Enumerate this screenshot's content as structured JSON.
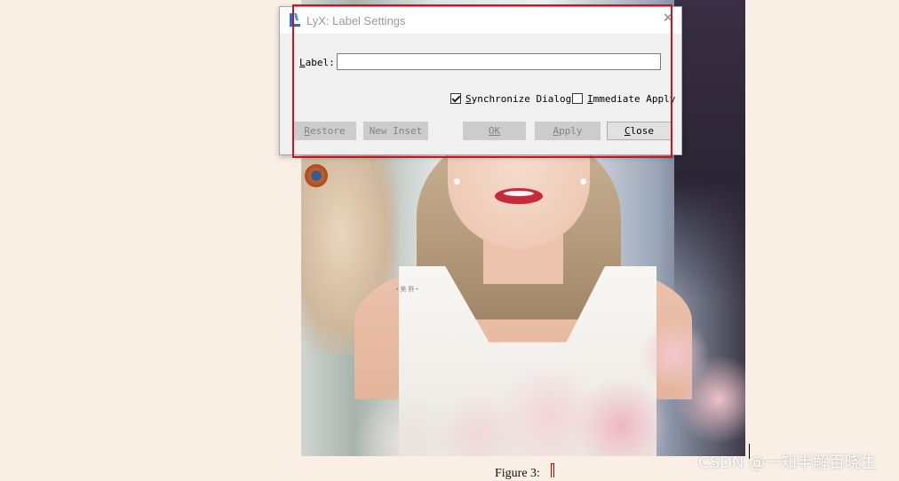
{
  "dialog": {
    "title": "LyX: Label Settings",
    "label_prefix": "L",
    "label_rest": "abel:",
    "label_value": "",
    "sync_checked": true,
    "sync_prefix": "S",
    "sync_rest": "ynchronize Dialog",
    "immediate_checked": false,
    "immediate_prefix": "I",
    "immediate_rest": "mmediate Apply",
    "buttons": {
      "restore_prefix": "R",
      "restore_rest": "estore",
      "new_inset": "New Inset",
      "ok": "OK",
      "apply_prefix": "A",
      "apply_rest": "pply",
      "close_prefix": "C",
      "close_rest": "lose"
    }
  },
  "document": {
    "caption": "Figure 3:",
    "photo_watermark": "• 美 野 •"
  },
  "watermark": "CSDN @一知半解百晓生",
  "colors": {
    "background": "#faefe5",
    "highlight_frame": "#d0121d",
    "lyx_icon_blue": "#1e6fd9"
  },
  "icons": [
    "lyx-app-icon",
    "close-icon",
    "checkbox-checked",
    "checkbox-unchecked"
  ]
}
